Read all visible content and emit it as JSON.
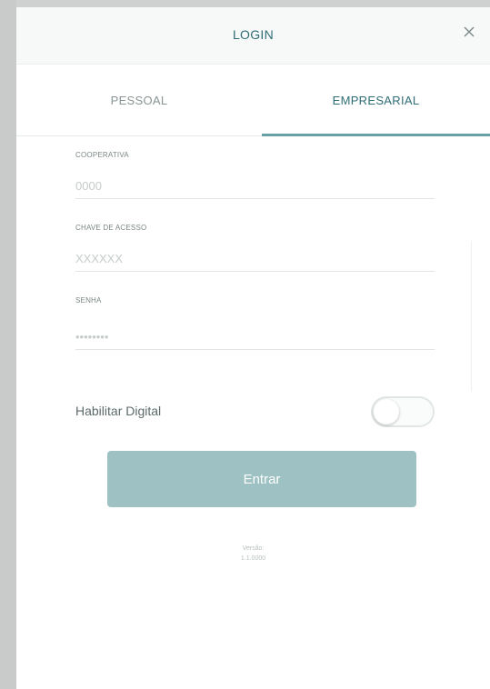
{
  "header": {
    "title": "LOGIN",
    "close_icon": "close-icon"
  },
  "tabs": [
    {
      "label": "PESSOAL",
      "active": false
    },
    {
      "label": "EMPRESARIAL",
      "active": true
    }
  ],
  "form": {
    "cooperativa": {
      "label": "COOPERATIVA",
      "placeholder": "0000"
    },
    "chave": {
      "label": "CHAVE DE ACESSO",
      "placeholder": "XXXXXX"
    },
    "senha": {
      "label": "SENHA",
      "placeholder": "••••••••"
    }
  },
  "digital": {
    "label": "Habilitar Digital",
    "enabled": false
  },
  "submit_label": "Entrar",
  "version": {
    "label": "Versão:",
    "value": "1.1.0000"
  },
  "colors": {
    "accent": "#2f6d75",
    "tab_indicator": "#6a9fa5",
    "button": "#9ec2c4",
    "backdrop": "#cfd1d1"
  }
}
